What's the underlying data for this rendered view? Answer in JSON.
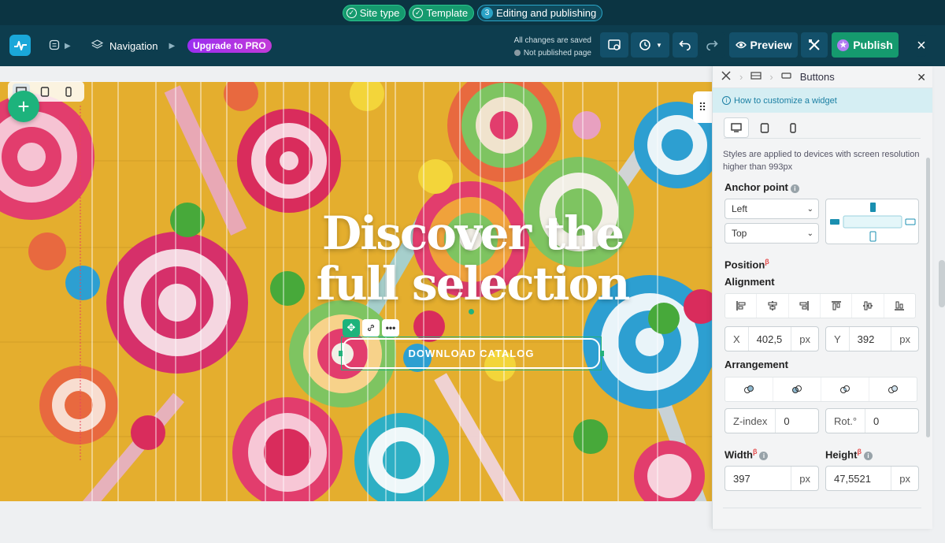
{
  "steps": [
    {
      "label": "Site type",
      "done": true
    },
    {
      "label": "Template",
      "done": true
    },
    {
      "label": "Editing and publishing",
      "number": "3",
      "done": false
    }
  ],
  "header": {
    "crumb_nav": "Navigation",
    "upgrade_label": "Upgrade to PRO",
    "saved_status": "All changes are saved",
    "publish_status": "Not published page",
    "preview_label": "Preview",
    "publish_label": "Publish"
  },
  "colors": {
    "accent": "#1db37c",
    "header": "#0d3d4e",
    "upgrade": "#a633e8"
  },
  "hero": {
    "headline_line1": "Discover the",
    "headline_line2": "full selection",
    "cta_label": "DOWNLOAD CATALOG"
  },
  "panel": {
    "title": "Buttons",
    "help_link": "How to customize a widget",
    "note": "Styles are applied to devices with screen resolution higher than 993px",
    "anchor_label": "Anchor point",
    "anchor_h": "Left",
    "anchor_v": "Top",
    "position_label": "Position",
    "beta": "β",
    "alignment_label": "Alignment",
    "x_prefix": "X",
    "x_value": "402,5",
    "x_unit": "px",
    "y_prefix": "Y",
    "y_value": "392",
    "y_unit": "px",
    "arrangement_label": "Arrangement",
    "zindex_prefix": "Z-index",
    "zindex_value": "0",
    "rot_prefix": "Rot.°",
    "rot_value": "0",
    "width_label": "Width",
    "width_value": "397",
    "width_unit": "px",
    "height_label": "Height",
    "height_value": "47,5521",
    "height_unit": "px"
  }
}
